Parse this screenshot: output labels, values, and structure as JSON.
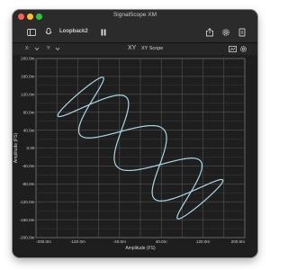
{
  "window": {
    "title": "SignalScope XM"
  },
  "toolbar": {
    "source": "Loopback2"
  },
  "subbar": {
    "x_label": "X:",
    "y_label": "Y:",
    "mode": "XY",
    "view_name": "XY Scope"
  },
  "chart_data": {
    "type": "line",
    "xlabel": "Amplitude (FS)",
    "ylabel": "Amplitude (FS)",
    "xlim": [
      -200,
      200
    ],
    "ylim": [
      -200,
      200
    ],
    "grid": true,
    "x_ticks": [
      "-200.0m",
      "-120.0m",
      "-40.0m",
      "40.0m",
      "120.0m",
      "200.0m"
    ],
    "y_ticks": [
      "200.0m",
      "160.0m",
      "120.0m",
      "80.0m",
      "40.0m",
      "0.00",
      "-40.0m",
      "-80.0m",
      "-120.0m",
      "-160.0m",
      "-200.0m"
    ],
    "series": [
      {
        "x_amp": 170,
        "x_freq": 1,
        "y_amp": 170,
        "y_freq": 5,
        "phase": 1.5708,
        "rotation_deg": -45
      }
    ],
    "colors": {
      "trace": "#a9d8e6",
      "grid": "#555555",
      "background": "#1e1e1e"
    }
  }
}
